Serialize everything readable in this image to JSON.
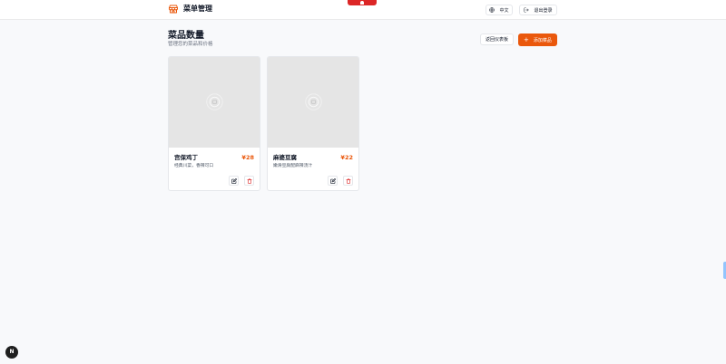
{
  "header": {
    "title": "菜单管理",
    "language_label": "中文",
    "logout_label": "退出登录"
  },
  "page": {
    "title": "菜品数量",
    "subtitle": "管理您的菜品和价格",
    "back_label": "返回仪表板",
    "add_label": "添加菜品"
  },
  "dishes": [
    {
      "name": "宫保鸡丁",
      "price": "¥28",
      "description": "经典川菜，香辣可口"
    },
    {
      "name": "麻婆豆腐",
      "price": "¥22",
      "description": "嫩滑豆腐配麻辣汤汁"
    }
  ],
  "devtools": {
    "badge_label": "N"
  },
  "colors": {
    "accent": "#ea580c",
    "danger": "#dc2626",
    "image_placeholder": "#e5e5e5"
  },
  "icons": [
    "store-icon",
    "globe-icon",
    "logout-icon",
    "plus-icon",
    "image-placeholder-icon",
    "edit-icon",
    "trash-icon"
  ]
}
